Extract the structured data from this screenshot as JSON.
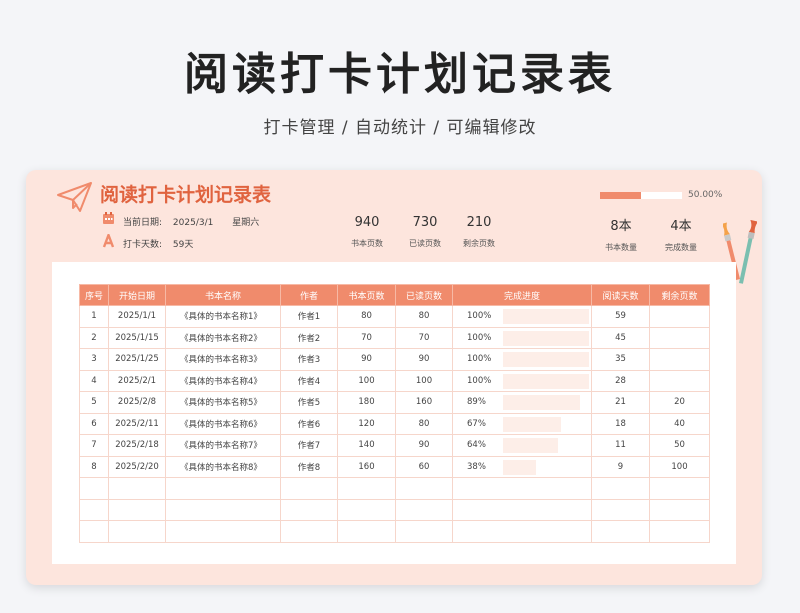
{
  "page": {
    "title": "阅读打卡计划记录表",
    "subtitle": "打卡管理 / 自动统计 /  可编辑修改"
  },
  "card": {
    "title": "阅读打卡计划记录表",
    "progress_text": "50.00%",
    "progress_value": 0.5,
    "date_label": "当前日期:",
    "date_value": "2025/3/1",
    "weekday": "星期六",
    "days_label": "打卡天数:",
    "days_value": "59天"
  },
  "stats": [
    {
      "value": "940",
      "label": "书本页数"
    },
    {
      "value": "730",
      "label": "已读页数"
    },
    {
      "value": "210",
      "label": "剩余页数"
    },
    {
      "value": "8本",
      "label": "书本数量"
    },
    {
      "value": "4本",
      "label": "完成数量"
    }
  ],
  "table": {
    "headers": [
      "序号",
      "开始日期",
      "书本名称",
      "作者",
      "书本页数",
      "已读页数",
      "完成进度",
      "阅读天数",
      "剩余页数"
    ],
    "rows": [
      {
        "no": "1",
        "date": "2025/1/1",
        "name": "《具体的书本名称1》",
        "author": "作者1",
        "pages": "80",
        "read": "80",
        "progress": "100%",
        "pct": 1.0,
        "days": "59",
        "remain": ""
      },
      {
        "no": "2",
        "date": "2025/1/15",
        "name": "《具体的书本名称2》",
        "author": "作者2",
        "pages": "70",
        "read": "70",
        "progress": "100%",
        "pct": 1.0,
        "days": "45",
        "remain": ""
      },
      {
        "no": "3",
        "date": "2025/1/25",
        "name": "《具体的书本名称3》",
        "author": "作者3",
        "pages": "90",
        "read": "90",
        "progress": "100%",
        "pct": 1.0,
        "days": "35",
        "remain": ""
      },
      {
        "no": "4",
        "date": "2025/2/1",
        "name": "《具体的书本名称4》",
        "author": "作者4",
        "pages": "100",
        "read": "100",
        "progress": "100%",
        "pct": 1.0,
        "days": "28",
        "remain": ""
      },
      {
        "no": "5",
        "date": "2025/2/8",
        "name": "《具体的书本名称5》",
        "author": "作者5",
        "pages": "180",
        "read": "160",
        "progress": "89%",
        "pct": 0.89,
        "days": "21",
        "remain": "20"
      },
      {
        "no": "6",
        "date": "2025/2/11",
        "name": "《具体的书本名称6》",
        "author": "作者6",
        "pages": "120",
        "read": "80",
        "progress": "67%",
        "pct": 0.67,
        "days": "18",
        "remain": "40"
      },
      {
        "no": "7",
        "date": "2025/2/18",
        "name": "《具体的书本名称7》",
        "author": "作者7",
        "pages": "140",
        "read": "90",
        "progress": "64%",
        "pct": 0.64,
        "days": "11",
        "remain": "50"
      },
      {
        "no": "8",
        "date": "2025/2/20",
        "name": "《具体的书本名称8》",
        "author": "作者8",
        "pages": "160",
        "read": "60",
        "progress": "38%",
        "pct": 0.38,
        "days": "9",
        "remain": "100"
      }
    ],
    "empty_rows": 3
  },
  "icons": {
    "logo": "paper-plane-icon",
    "date": "calendar-icon",
    "days": "user-icon",
    "decoration": "paintbrush-icon"
  },
  "colors": {
    "accent": "#f08b6c",
    "title": "#e0633f",
    "card_bg": "#fde5dd"
  }
}
